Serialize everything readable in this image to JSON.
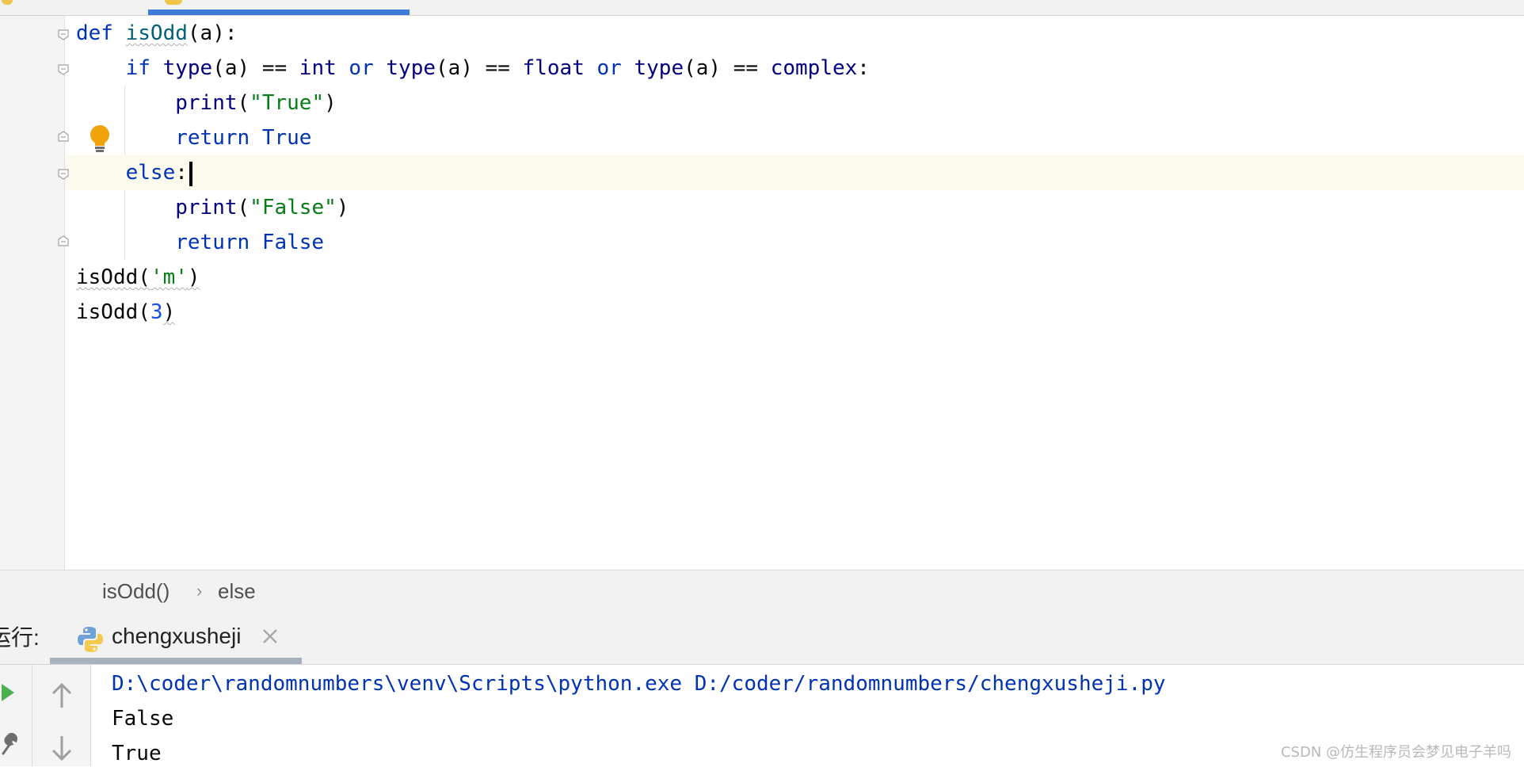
{
  "editor": {
    "code": {
      "l1_def": "def",
      "l1_name": "isOdd",
      "l1_rest": "(a):",
      "l2_if": "if",
      "l2_type1": "type",
      "l2_a1": "(a) == ",
      "l2_int": "int",
      "l2_or1": "or",
      "l2_type2": "type",
      "l2_a2": "(a) == ",
      "l2_float": "float",
      "l2_or2": "or",
      "l2_type3": "type",
      "l2_a3": "(a) == ",
      "l2_complex": "complex",
      "l2_colon": ":",
      "l3_print": "print",
      "l3_open": "(",
      "l3_str": "\"True\"",
      "l3_close": ")",
      "l4_return": "return",
      "l4_val": "True",
      "l5_else": "else",
      "l5_colon": ":",
      "l6_print": "print",
      "l6_open": "(",
      "l6_str": "\"False\"",
      "l6_close": ")",
      "l7_return": "return",
      "l7_val": "False",
      "l8_call": "isOdd(",
      "l8_arg": "'m'",
      "l8_close": ")",
      "l9_call": "isOdd(",
      "l9_arg": "3",
      "l9_close": ")"
    }
  },
  "breadcrumb": {
    "items": [
      "isOdd()",
      "else"
    ],
    "separator": "›"
  },
  "run": {
    "label": "运行:",
    "tab_name": "chengxusheji"
  },
  "console": {
    "command": "D:\\coder\\randomnumbers\\venv\\Scripts\\python.exe D:/coder/randomnumbers/chengxusheji.py",
    "output": [
      "False",
      "True"
    ]
  },
  "watermark": "CSDN @仿生程序员会梦见电子羊吗",
  "colors": {
    "keyword": "#0033b3",
    "string": "#067d17",
    "number": "#1750eb",
    "function": "#00627a",
    "caret_line": "#fcfaed",
    "accent": "#3d7bd9"
  },
  "icons": {
    "intention": "lightbulb-icon",
    "run": "play-icon",
    "settings": "wrench-icon",
    "scroll_up": "arrow-up-icon",
    "scroll_down": "arrow-down-icon",
    "file": "python-icon",
    "close": "close-icon"
  }
}
